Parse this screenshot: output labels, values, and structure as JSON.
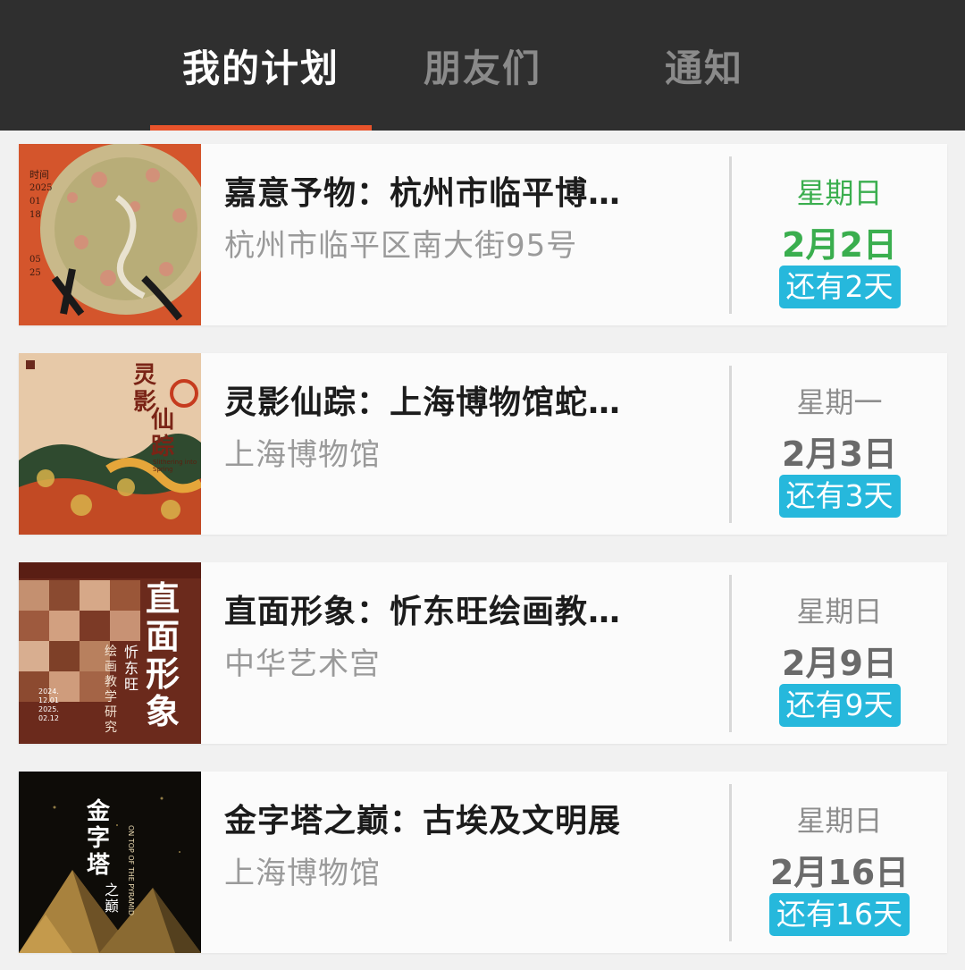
{
  "tabs": [
    "我的计划",
    "朋友们",
    "通知"
  ],
  "colors": {
    "accent": "#e8532b",
    "today": "#3aae4e",
    "badge": "#26b8dc"
  },
  "events": [
    {
      "title": "嘉意予物：杭州市临平博…",
      "venue": "杭州市临平区南大街95号",
      "weekday": "星期日",
      "date": "2月2日",
      "countdown": "还有2天",
      "poster": {
        "label": "时间",
        "dates": [
          "2025",
          "01",
          "18",
          "05",
          "25"
        ]
      }
    },
    {
      "title": "灵影仙踪：上海博物馆蛇…",
      "venue": "上海博物馆",
      "weekday": "星期一",
      "date": "2月3日",
      "countdown": "还有3天",
      "poster": {
        "title_chars": [
          "灵",
          "影",
          "仙",
          "踪"
        ],
        "subtitle": "Slithering into Spring"
      }
    },
    {
      "title": "直面形象：忻东旺绘画教…",
      "venue": "中华艺术宫",
      "weekday": "星期日",
      "date": "2月9日",
      "countdown": "还有9天",
      "poster": {
        "title_chars": [
          "直",
          "面",
          "形",
          "象"
        ],
        "artist": "忻东旺",
        "subtitle": "绘画教学研究",
        "dates": [
          "2024.",
          "12.01",
          "2025.",
          "02.12"
        ]
      }
    },
    {
      "title": "金字塔之巅：古埃及文明展",
      "venue": "上海博物馆",
      "weekday": "星期日",
      "date": "2月16日",
      "countdown": "还有16天",
      "poster": {
        "title_chars": [
          "金",
          "字",
          "塔",
          "之",
          "巅"
        ],
        "en": "ON TOP OF THE PYRAMID"
      }
    }
  ]
}
